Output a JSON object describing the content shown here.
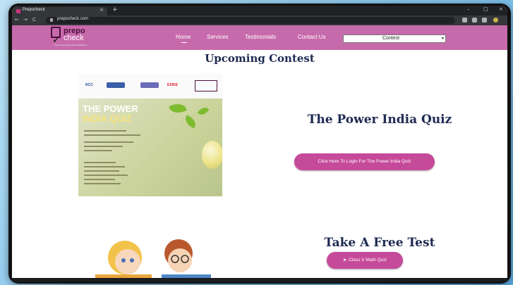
{
  "browser": {
    "tab_title": "Prepocheck",
    "tab_close": "×",
    "new_tab": "+",
    "url": "prepocheck.com",
    "window_controls": [
      "–",
      "□",
      "×"
    ],
    "nav_icons": [
      "←",
      "→",
      "C"
    ]
  },
  "site": {
    "logo_prepo": "prepo",
    "logo_check": "check",
    "logo_mark": "✓",
    "logo_tagline": "The online exploration Platform",
    "menu": [
      "Home",
      "Services",
      "Testimonials",
      "Contact Us"
    ],
    "select_value": "Contest",
    "select_arrow": "▾"
  },
  "main": {
    "section_title": "Upcoming Contest",
    "poster": {
      "logos": [
        "RCC",
        "EXIDE"
      ],
      "title_line1": "THE POWER",
      "title_line2": "INDIA QUIZ"
    },
    "contest_title": "The Power India Quiz",
    "login_button": "Click Here To Login For The Power India Quiz",
    "free_test_title": "Take A Free Test",
    "quiz_button": "► Class V Math Quiz"
  },
  "colors": {
    "nav_bg": "#c76aac",
    "accent": "#c64a9a",
    "heading": "#1e2a52"
  }
}
